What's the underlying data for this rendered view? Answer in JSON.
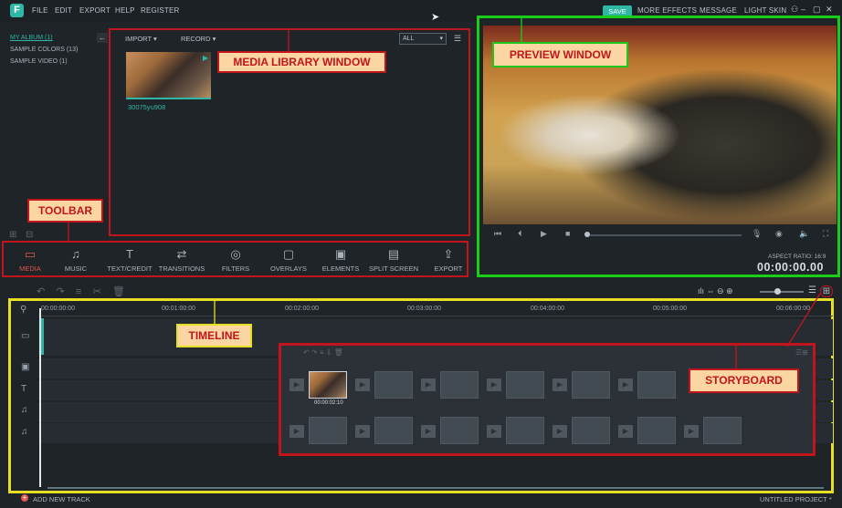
{
  "app": {
    "logo_letter": "F"
  },
  "menu": [
    "FILE",
    "EDIT",
    "EXPORT",
    "HELP",
    "REGISTER"
  ],
  "top_right": {
    "save": "SAVE",
    "more_effects": "MORE EFFECTS",
    "message": "MESSAGE",
    "light_skin": "LIGHT SKIN"
  },
  "albums": [
    "MY ALBUM (1)",
    "SAMPLE COLORS (13)",
    "SAMPLE VIDEO (1)"
  ],
  "media": {
    "import": "IMPORT",
    "record": "RECORD",
    "filter_value": "ALL",
    "clip_name": "30075yu908"
  },
  "annotations": {
    "media_library": "MEDIA LIBRARY WINDOW",
    "preview": "PREVIEW WINDOW",
    "toolbar": "TOOLBAR",
    "timeline": "TIMELINE",
    "storyboard": "STORYBOARD"
  },
  "toolbar": [
    {
      "label": "MEDIA",
      "icon": "folder-icon",
      "glyph": "▭"
    },
    {
      "label": "MUSIC",
      "icon": "music-icon",
      "glyph": "♫"
    },
    {
      "label": "TEXT/CREDIT",
      "icon": "text-icon",
      "glyph": "T"
    },
    {
      "label": "TRANSITIONS",
      "icon": "transitions-icon",
      "glyph": "⇄"
    },
    {
      "label": "FILTERS",
      "icon": "filters-icon",
      "glyph": "◎"
    },
    {
      "label": "OVERLAYS",
      "icon": "overlays-icon",
      "glyph": "▢"
    },
    {
      "label": "ELEMENTS",
      "icon": "elements-icon",
      "glyph": "▣"
    },
    {
      "label": "SPLIT SCREEN",
      "icon": "split-screen-icon",
      "glyph": "▤"
    },
    {
      "label": "EXPORT",
      "icon": "export-icon",
      "glyph": "⇪"
    }
  ],
  "preview": {
    "aspect_ratio": "ASPECT RATIO: 16:9",
    "timecode": "00:00:00.00"
  },
  "timeline": {
    "ticks": [
      "00:00:00:00",
      "00:01:00:00",
      "00:02:00:00",
      "00:03:00:00",
      "00:04:00:00",
      "00:05:00:00",
      "00:06:00:00"
    ]
  },
  "storyboard": {
    "clip_time": "00:00:02:10"
  },
  "bottom": {
    "add_track": "ADD NEW TRACK",
    "project": "UNTITLED PROJECT *"
  },
  "colors": {
    "accent": "#2fb7a5",
    "red_outline": "#c0161b",
    "green_outline": "#19cd19",
    "yellow_outline": "#e7df23",
    "label_bg": "#fbd6a2"
  }
}
